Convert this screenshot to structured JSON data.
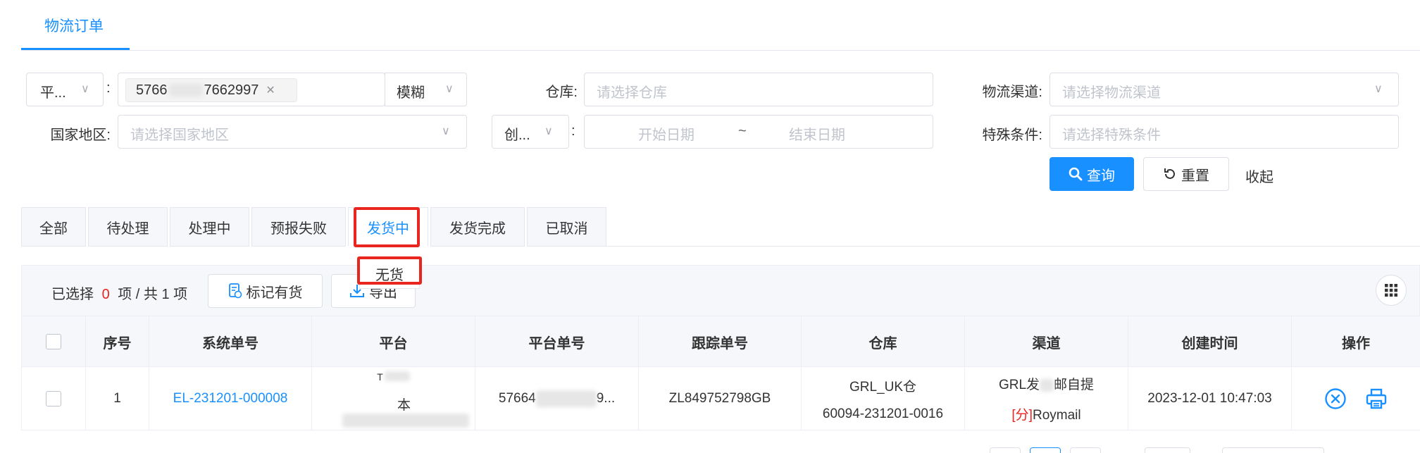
{
  "tabs_top": {
    "active": "物流订单"
  },
  "filters": {
    "platform_select": "平...",
    "colon": ":",
    "order_tag_prefix": "5766",
    "order_tag_suffix": "7662997",
    "match_mode": "模糊",
    "warehouse_label": "仓库:",
    "warehouse_placeholder": "请选择仓库",
    "channel_label": "物流渠道:",
    "channel_placeholder": "请选择物流渠道",
    "country_label": "国家地区:",
    "country_placeholder": "请选择国家地区",
    "date_type": "创...",
    "start_date": "开始日期",
    "date_sep": "~",
    "end_date": "结束日期",
    "special_label": "特殊条件:",
    "special_placeholder": "请选择特殊条件",
    "search_btn": "查询",
    "reset_btn": "重置",
    "collapse_btn": "收起"
  },
  "status_tabs": [
    "全部",
    "待处理",
    "处理中",
    "预报失败",
    "发货中",
    "发货完成",
    "已取消"
  ],
  "status_active": "发货中",
  "dropdown_item": "无货",
  "toolbar": {
    "selected_prefix": "已选择",
    "selected_count": "0",
    "selected_suffix": "项 / 共 1 项",
    "mark_stock_btn": "标记有货",
    "export_btn": "导出"
  },
  "table": {
    "headers": [
      "序号",
      "系统单号",
      "平台",
      "平台单号",
      "跟踪单号",
      "仓库",
      "渠道",
      "创建时间",
      "操作"
    ],
    "row": {
      "index": "1",
      "system_no": "EL-231201-000008",
      "platform_line1": "T",
      "platform_line2": "本",
      "platform_no": "57664",
      "platform_no_tail": "9...",
      "tracking_no": "ZL849752798GB",
      "warehouse_line1": "GRL_UK仓",
      "warehouse_line2": "60094-231201-0016",
      "channel_line1_a": "GRL发",
      "channel_line1_b": "邮自提",
      "channel_tag": "[分]",
      "channel_line2": "Roymail",
      "created_at": "2023-12-01 10:47:03"
    }
  },
  "colors": {
    "primary": "#1890ff",
    "highlight": "#e8251f"
  }
}
